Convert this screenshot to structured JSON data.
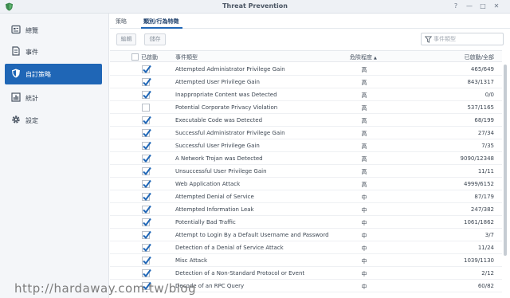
{
  "window": {
    "title": "Threat Prevention",
    "controls": [
      "?",
      "—",
      "□",
      "✕"
    ]
  },
  "sidebar": {
    "items": [
      {
        "label": "總覽",
        "icon": "overview-icon",
        "active": false
      },
      {
        "label": "事件",
        "icon": "events-icon",
        "active": false
      },
      {
        "label": "自訂策略",
        "icon": "shield-icon",
        "active": true
      },
      {
        "label": "統計",
        "icon": "statistics-icon",
        "active": false
      },
      {
        "label": "設定",
        "icon": "gear-icon",
        "active": false
      }
    ]
  },
  "tabs": [
    {
      "label": "策略",
      "active": false
    },
    {
      "label": "類別/行為特徵",
      "active": true
    }
  ],
  "toolbar": {
    "edit_label": "編輯",
    "save_label": "儲存",
    "search_placeholder": "事件類型"
  },
  "table": {
    "headers": {
      "enabled": "已啟動",
      "type": "事件類型",
      "risk": "危險程度",
      "count": "已啟動/全部"
    },
    "rows": [
      {
        "checked": true,
        "type": "Attempted Administrator Privilege Gain",
        "risk": "高",
        "count": "465/649"
      },
      {
        "checked": true,
        "type": "Attempted User Privilege Gain",
        "risk": "高",
        "count": "843/1317"
      },
      {
        "checked": true,
        "type": "Inappropriate Content was Detected",
        "risk": "高",
        "count": "0/0"
      },
      {
        "checked": false,
        "type": "Potential Corporate Privacy Violation",
        "risk": "高",
        "count": "537/1165"
      },
      {
        "checked": true,
        "type": "Executable Code was Detected",
        "risk": "高",
        "count": "68/199"
      },
      {
        "checked": true,
        "type": "Successful Administrator Privilege Gain",
        "risk": "高",
        "count": "27/34"
      },
      {
        "checked": true,
        "type": "Successful User Privilege Gain",
        "risk": "高",
        "count": "7/35"
      },
      {
        "checked": true,
        "type": "A Network Trojan was Detected",
        "risk": "高",
        "count": "9090/12348"
      },
      {
        "checked": true,
        "type": "Unsuccessful User Privilege Gain",
        "risk": "高",
        "count": "11/11"
      },
      {
        "checked": true,
        "type": "Web Application Attack",
        "risk": "高",
        "count": "4999/6152"
      },
      {
        "checked": true,
        "type": "Attempted Denial of Service",
        "risk": "中",
        "count": "87/179"
      },
      {
        "checked": true,
        "type": "Attempted Information Leak",
        "risk": "中",
        "count": "247/382"
      },
      {
        "checked": true,
        "type": "Potentially Bad Traffic",
        "risk": "中",
        "count": "1061/1862"
      },
      {
        "checked": true,
        "type": "Attempt to Login By a Default Username and Password",
        "risk": "中",
        "count": "3/7"
      },
      {
        "checked": true,
        "type": "Detection of a Denial of Service Attack",
        "risk": "中",
        "count": "11/24"
      },
      {
        "checked": true,
        "type": "Misc Attack",
        "risk": "中",
        "count": "1039/1130"
      },
      {
        "checked": true,
        "type": "Detection of a Non-Standard Protocol or Event",
        "risk": "中",
        "count": "2/12"
      },
      {
        "checked": true,
        "type": "Decode of an RPC Query",
        "risk": "中",
        "count": "60/82"
      }
    ]
  },
  "watermark": "http://hardaway.com.tw/blog",
  "colors": {
    "accent": "#1f66b6",
    "check": "#1f66b6"
  }
}
